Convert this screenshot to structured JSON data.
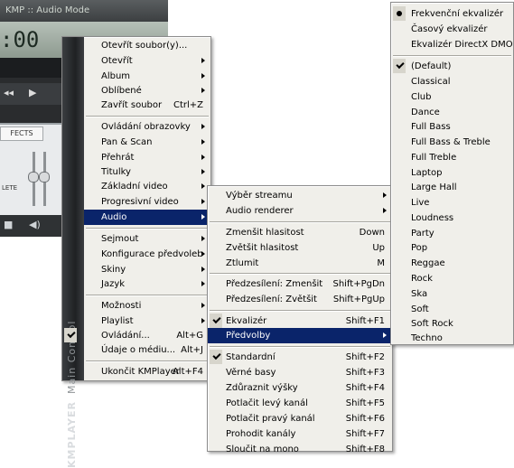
{
  "player": {
    "title": "KMP :: Audio Mode",
    "time_display": ":00",
    "effects_tab": "FECTS",
    "effects_button": "LETE",
    "side_brand": "KMPLAYER",
    "side_sub": "Main Control"
  },
  "main_menu": {
    "items": [
      {
        "label": "Otevřít soubor(y)...",
        "shortcut": "",
        "submenu": false
      },
      {
        "label": "Otevřít",
        "shortcut": "",
        "submenu": true
      },
      {
        "label": "Album",
        "shortcut": "",
        "submenu": true
      },
      {
        "label": "Oblíbené",
        "shortcut": "",
        "submenu": true
      },
      {
        "label": "Zavřít soubor",
        "shortcut": "Ctrl+Z",
        "submenu": false
      },
      {
        "label": "Ovládání obrazovky",
        "shortcut": "",
        "submenu": true
      },
      {
        "label": "Pan & Scan",
        "shortcut": "",
        "submenu": true
      },
      {
        "label": "Přehrát",
        "shortcut": "",
        "submenu": true
      },
      {
        "label": "Titulky",
        "shortcut": "",
        "submenu": true
      },
      {
        "label": "Základní video",
        "shortcut": "",
        "submenu": true
      },
      {
        "label": "Progresivní video",
        "shortcut": "",
        "submenu": true
      },
      {
        "label": "Audio",
        "shortcut": "",
        "submenu": true,
        "highlighted": true
      },
      {
        "label": "Sejmout",
        "shortcut": "",
        "submenu": true
      },
      {
        "label": "Konfigurace předvoleb",
        "shortcut": "",
        "submenu": true
      },
      {
        "label": "Skiny",
        "shortcut": "",
        "submenu": true
      },
      {
        "label": "Jazyk",
        "shortcut": "",
        "submenu": true
      },
      {
        "label": "Možnosti",
        "shortcut": "",
        "submenu": true
      },
      {
        "label": "Playlist",
        "shortcut": "",
        "submenu": true
      },
      {
        "label": "Ovládání...",
        "shortcut": "Alt+G",
        "submenu": false,
        "checked": true
      },
      {
        "label": "Údaje o médiu...",
        "shortcut": "Alt+J",
        "submenu": false
      },
      {
        "label": "Ukončit KMPlayer",
        "shortcut": "Alt+F4",
        "submenu": false
      }
    ]
  },
  "audio_menu": {
    "items": [
      {
        "label": "Výběr streamu",
        "shortcut": "",
        "submenu": true
      },
      {
        "label": "Audio renderer",
        "shortcut": "",
        "submenu": true
      },
      {
        "label": "Zmenšit hlasitost",
        "shortcut": "Down",
        "submenu": false
      },
      {
        "label": "Zvětšit hlasitost",
        "shortcut": "Up",
        "submenu": false
      },
      {
        "label": "Ztlumit",
        "shortcut": "M",
        "submenu": false
      },
      {
        "label": "Předzesílení: Zmenšit",
        "shortcut": "Shift+PgDn",
        "submenu": false
      },
      {
        "label": "Předzesílení: Zvětšit",
        "shortcut": "Shift+PgUp",
        "submenu": false
      },
      {
        "label": "Ekvalizér",
        "shortcut": "Shift+F1",
        "submenu": false,
        "checked": true
      },
      {
        "label": "Předvolby",
        "shortcut": "",
        "submenu": true,
        "highlighted": true
      },
      {
        "label": "Standardní",
        "shortcut": "Shift+F2",
        "submenu": false,
        "checked": true
      },
      {
        "label": "Věrné basy",
        "shortcut": "Shift+F3",
        "submenu": false
      },
      {
        "label": "Zdůraznit výšky",
        "shortcut": "Shift+F4",
        "submenu": false
      },
      {
        "label": "Potlačit levý kanál",
        "shortcut": "Shift+F5",
        "submenu": false
      },
      {
        "label": "Potlačit pravý kanál",
        "shortcut": "Shift+F6",
        "submenu": false
      },
      {
        "label": "Prohodit kanály",
        "shortcut": "Shift+F7",
        "submenu": false
      },
      {
        "label": "Sloučit na mono",
        "shortcut": "Shift+F8",
        "submenu": false
      }
    ]
  },
  "presets_menu": {
    "items": [
      {
        "label": "Frekvenční ekvalizér",
        "radio": true
      },
      {
        "label": "Časový ekvalizér"
      },
      {
        "label": "Ekvalizér DirectX DMO"
      },
      {
        "label": "(Default)",
        "checked": true
      },
      {
        "label": "Classical"
      },
      {
        "label": "Club"
      },
      {
        "label": "Dance"
      },
      {
        "label": "Full Bass"
      },
      {
        "label": "Full Bass & Treble"
      },
      {
        "label": "Full Treble"
      },
      {
        "label": "Laptop"
      },
      {
        "label": "Large Hall"
      },
      {
        "label": "Live"
      },
      {
        "label": "Loudness"
      },
      {
        "label": "Party"
      },
      {
        "label": "Pop"
      },
      {
        "label": "Reggae"
      },
      {
        "label": "Rock"
      },
      {
        "label": "Ska"
      },
      {
        "label": "Soft"
      },
      {
        "label": "Soft Rock"
      },
      {
        "label": "Techno"
      }
    ]
  }
}
